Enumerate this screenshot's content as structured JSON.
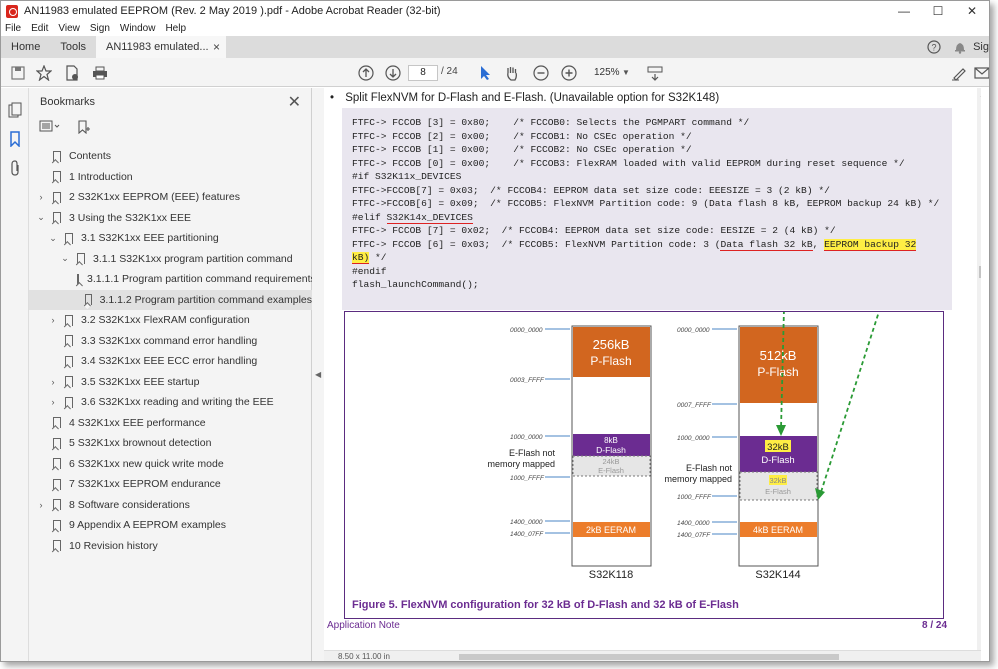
{
  "window": {
    "title": "AN11983 emulated EEPROM (Rev. 2  May 2019 ).pdf - Adobe Acrobat Reader (32-bit)",
    "min_glyph": "—",
    "max_glyph": "☐",
    "close_glyph": "✕"
  },
  "menu": [
    "File",
    "Edit",
    "View",
    "Sign",
    "Window",
    "Help"
  ],
  "tabs": {
    "home": "Home",
    "tools": "Tools",
    "doc": "AN11983 emulated...",
    "doc_close": "×",
    "signin": "Sig"
  },
  "toolbar": {
    "page_current": "8",
    "page_total": "/ 24",
    "zoom": "125%"
  },
  "bookmarks": {
    "title": "Bookmarks",
    "close": "✕",
    "items": [
      {
        "label": "Contents",
        "chevron": ""
      },
      {
        "label": "1 Introduction",
        "chevron": ""
      },
      {
        "label": "2 S32K1xx EEPROM (EEE) features",
        "chevron": "›"
      },
      {
        "label": "3 Using the S32K1xx EEE",
        "chevron": "⌄"
      },
      {
        "label": "3.1 S32K1xx EEE partitioning",
        "chevron": "⌄"
      },
      {
        "label": "3.1.1 S32K1xx program partition command",
        "chevron": "⌄"
      },
      {
        "label": "3.1.1.1 Program partition command requirements",
        "chevron": ""
      },
      {
        "label": "3.1.1.2 Program partition command examples",
        "chevron": ""
      },
      {
        "label": "3.2 S32K1xx FlexRAM configuration",
        "chevron": "›"
      },
      {
        "label": "3.3 S32K1xx command error handling",
        "chevron": ""
      },
      {
        "label": "3.4 S32K1xx EEE ECC error handling",
        "chevron": ""
      },
      {
        "label": "3.5 S32K1xx EEE startup",
        "chevron": "›"
      },
      {
        "label": "3.6 S32K1xx reading and writing the EEE",
        "chevron": "›"
      },
      {
        "label": "4 S32K1xx EEE performance",
        "chevron": ""
      },
      {
        "label": "5 S32K1xx brownout detection",
        "chevron": ""
      },
      {
        "label": "6 S32K1xx new quick write mode",
        "chevron": ""
      },
      {
        "label": "7 S32K1xx EEPROM endurance",
        "chevron": ""
      },
      {
        "label": "8 Software considerations",
        "chevron": "›"
      },
      {
        "label": "9 Appendix A EEPROM examples",
        "chevron": ""
      },
      {
        "label": "10 Revision history",
        "chevron": ""
      }
    ],
    "selected_index": 7
  },
  "document": {
    "bullet": "Split FlexNVM for D-Flash and E-Flash. (Unavailable option for S32K148)",
    "code": {
      "l1": "FTFC-> FCCOB [3] = 0x80;    /* FCCOB0: Selects the PGMPART command */",
      "l2": "FTFC-> FCCOB [2] = 0x00;    /* FCCOB1: No CSEc operation */",
      "l3": "FTFC-> FCCOB [1] = 0x00;    /* FCCOB2: No CSEc operation */",
      "l4": "FTFC-> FCCOB [0] = 0x00;    /* FCCOB3: FlexRAM loaded with valid EEPROM during reset sequence */",
      "l5": "#if S32K11x_DEVICES",
      "l6": "FTFC->FCCOB[7] = 0x03;  /* FCCOB4: EEPROM data set size code: EEESIZE = 3 (2 kB) */",
      "l7": "FTFC->FCCOB[6] = 0x09;  /* FCCOB5: FlexNVM Partition code: 9 (Data flash 8 kB, EEPROM backup 24 kB) */",
      "l8a": "#elif ",
      "l8b": "S32K14x_DEVICES",
      "l9": "FTFC-> FCCOB [7] = 0x02;  /* FCCOB4: EEPROM data set size code: EESIZE = 2 (4 kB) */",
      "l10a": "FTFC-> FCCOB [6] = 0x03;  /* FCCOB5: FlexNVM Partition code: 3 (",
      "l10b": "Data flash 32 kB",
      "l10c": ", ",
      "l10d": "EEPROM backup 32",
      "l11a": "kB)",
      "l11b": " */",
      "l12": "#endif",
      "l13": "flash_launchCommand();"
    },
    "figure": {
      "left_chip": "S32K118",
      "right_chip": "S32K144",
      "left_pflash_size": "256kB",
      "left_pflash_label": "P-Flash",
      "left_dflash_size": "8kB",
      "left_dflash_label": "D-Flash",
      "left_eflash_size": "24kB",
      "left_eflash_label": "E-Flash",
      "left_eeeram": "2kB EERAM",
      "right_pflash_size": "512kB",
      "right_pflash_label": "P-Flash",
      "right_dflash_size": "32kB",
      "right_dflash_label": "D-Flash",
      "right_eflash_size": "32kB",
      "right_eflash_label": "E-Flash",
      "right_eeeram": "4kB EERAM",
      "eflash_note_1": "E-Flash not",
      "eflash_note_2": "memory mapped",
      "addr_l_0000": "0000_0000",
      "addr_l_3ffff": "0003_FFFF",
      "addr_l_1000": "1000_0000",
      "addr_l_1000ffff": "1000_FFFF",
      "addr_l_1400": "1400_0000",
      "addr_l_14007ff": "1400_07FF",
      "addr_r_0000": "0000_0000",
      "addr_r_7ffff": "0007_FFFF",
      "addr_r_1000": "1000_0000",
      "addr_r_1000ffff": "1000_FFFF",
      "addr_r_1400": "1400_0000",
      "addr_r_14007ff": "1400_07FF",
      "caption": "Figure 5.  FlexNVM configuration for 32 kB of D-Flash and 32 kB of E-Flash"
    },
    "footer_left": "Application Note",
    "footer_right": "8 / 24",
    "page_size": "8.50 x 11.00 in"
  },
  "colors": {
    "pflash": "#d2661f",
    "dflash": "#6b2c91",
    "eflash": "#e6e6e6",
    "eeeram": "#ec7d2b",
    "accent_green": "#2a9a35",
    "highlight": "#ffee44"
  }
}
